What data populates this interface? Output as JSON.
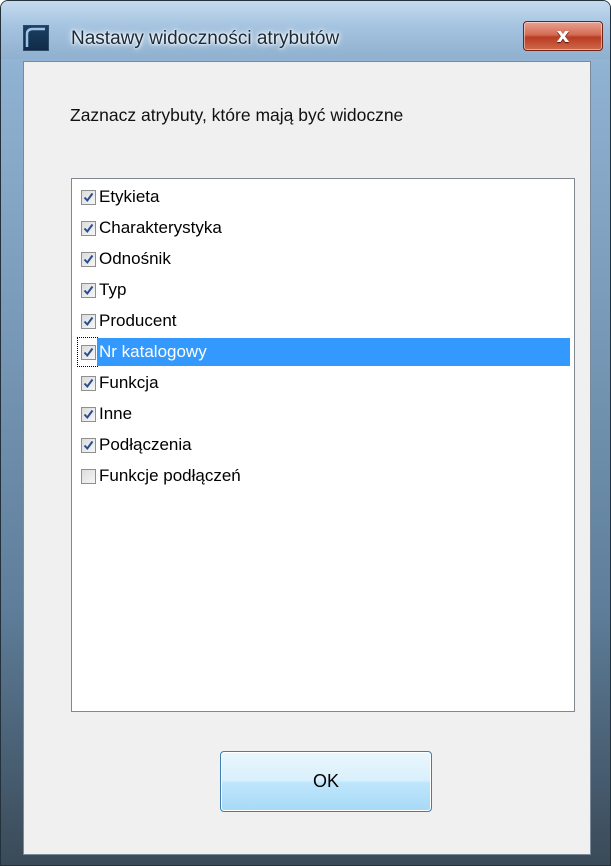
{
  "window": {
    "title": "Nastawy widoczności atrybutów",
    "close_label": "x"
  },
  "dialog": {
    "instruction": "Zaznacz atrybuty, które mają być widoczne",
    "ok_label": "OK"
  },
  "attributes": [
    {
      "label": "Etykieta",
      "checked": true,
      "selected": false
    },
    {
      "label": "Charakterystyka",
      "checked": true,
      "selected": false
    },
    {
      "label": "Odnośnik",
      "checked": true,
      "selected": false
    },
    {
      "label": "Typ",
      "checked": true,
      "selected": false
    },
    {
      "label": "Producent",
      "checked": true,
      "selected": false
    },
    {
      "label": "Nr katalogowy",
      "checked": true,
      "selected": true
    },
    {
      "label": "Funkcja",
      "checked": true,
      "selected": false
    },
    {
      "label": "Inne",
      "checked": true,
      "selected": false
    },
    {
      "label": "Podłączenia",
      "checked": true,
      "selected": false
    },
    {
      "label": "Funkcje podłączeń",
      "checked": false,
      "selected": false
    }
  ],
  "colors": {
    "selection": "#3399ff",
    "checkmark": "#2a4d8f"
  }
}
